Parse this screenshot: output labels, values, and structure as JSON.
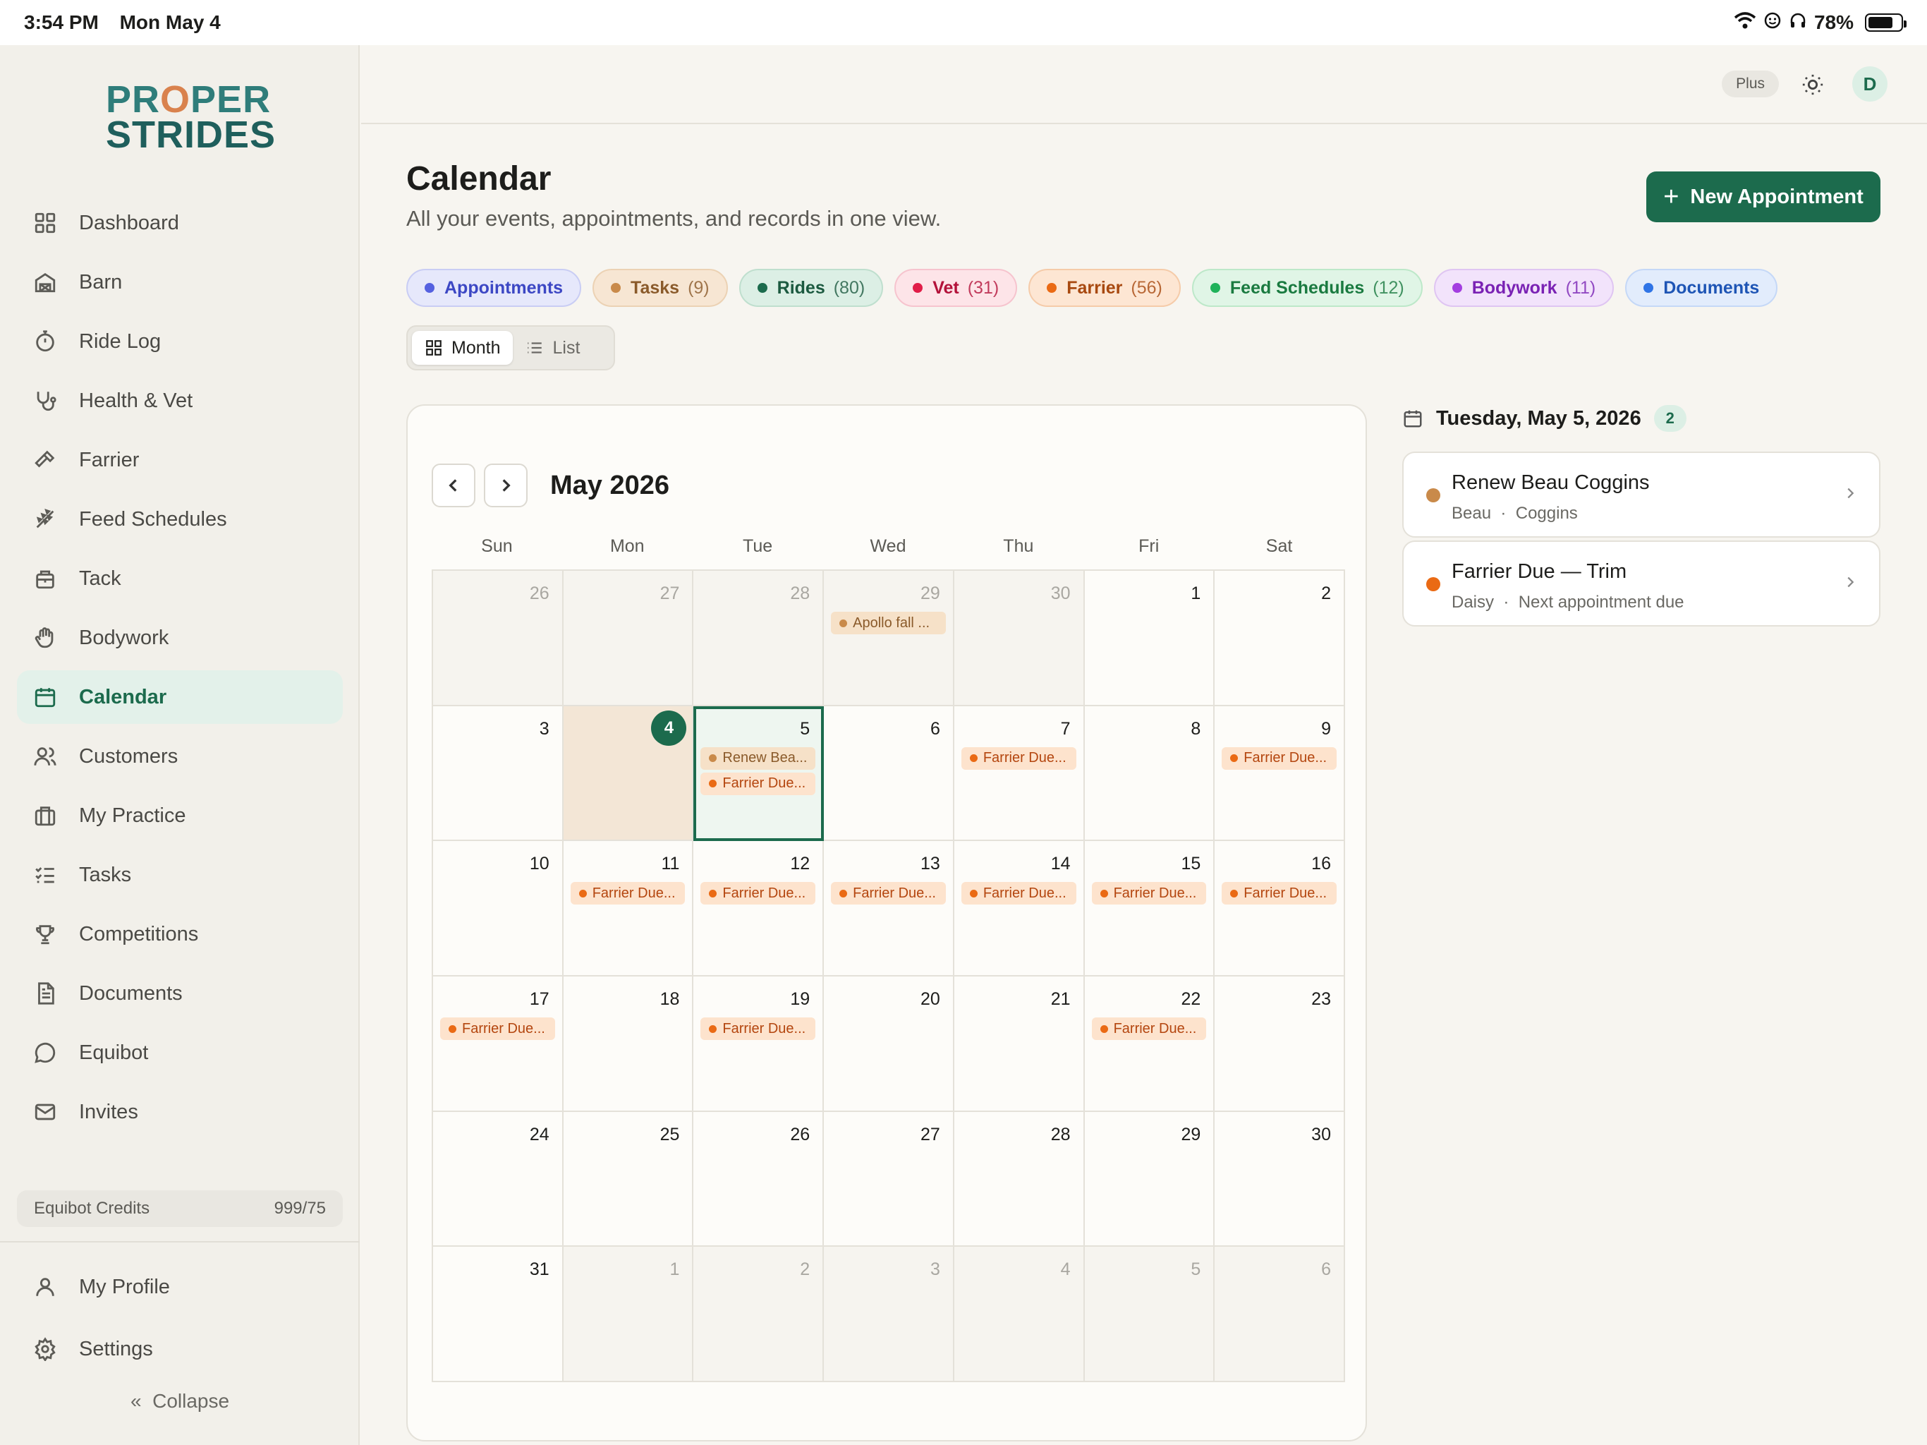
{
  "status": {
    "time": "3:54 PM",
    "date": "Mon May 4",
    "battery": "78%",
    "battery_level": 0.78
  },
  "logo": {
    "line1_a": "PR",
    "line1_o": "O",
    "line1_b": "PER",
    "line2": "STRIDES"
  },
  "nav": [
    {
      "label": "Dashboard",
      "icon": "dashboard-icon"
    },
    {
      "label": "Barn",
      "icon": "barn-icon"
    },
    {
      "label": "Ride Log",
      "icon": "stopwatch-icon"
    },
    {
      "label": "Health & Vet",
      "icon": "stethoscope-icon"
    },
    {
      "label": "Farrier",
      "icon": "hammer-icon"
    },
    {
      "label": "Feed Schedules",
      "icon": "wheat-icon"
    },
    {
      "label": "Tack",
      "icon": "tack-icon"
    },
    {
      "label": "Bodywork",
      "icon": "hand-icon"
    },
    {
      "label": "Calendar",
      "icon": "calendar-icon",
      "active": true
    },
    {
      "label": "Customers",
      "icon": "users-icon"
    },
    {
      "label": "My Practice",
      "icon": "briefcase-icon"
    },
    {
      "label": "Tasks",
      "icon": "checklist-icon"
    },
    {
      "label": "Competitions",
      "icon": "trophy-icon"
    },
    {
      "label": "Documents",
      "icon": "document-icon"
    },
    {
      "label": "Equibot",
      "icon": "chat-icon"
    },
    {
      "label": "Invites",
      "icon": "mail-icon"
    }
  ],
  "credits": {
    "label": "Equibot Credits",
    "value": "999/75"
  },
  "bottom_nav": [
    {
      "label": "My Profile",
      "icon": "user-icon"
    },
    {
      "label": "Settings",
      "icon": "gear-icon"
    }
  ],
  "collapse_label": "Collapse",
  "topbar": {
    "plan": "Plus",
    "avatar_letter": "D"
  },
  "header": {
    "title": "Calendar",
    "subtitle": "All your events, appointments, and records in one view.",
    "new_button": "New Appointment"
  },
  "filters": [
    {
      "label": "Appointments",
      "count": "",
      "color": "#5561e0",
      "bg": "#e6e8fb",
      "border": "#c9cdf4",
      "text": "#3c47c4"
    },
    {
      "label": "Tasks",
      "count": "(9)",
      "color": "#c98a4a",
      "bg": "#f7e6d3",
      "border": "#ecd2b4",
      "text": "#8a5a2a"
    },
    {
      "label": "Rides",
      "count": "(80)",
      "color": "#1c6b4d",
      "bg": "#dcefe5",
      "border": "#bfdfce",
      "text": "#1c5a40"
    },
    {
      "label": "Vet",
      "count": "(31)",
      "color": "#e11d48",
      "bg": "#fde4e8",
      "border": "#f6c4ce",
      "text": "#b3123a"
    },
    {
      "label": "Farrier",
      "count": "(56)",
      "color": "#ea6a14",
      "bg": "#fde6d3",
      "border": "#f5cba9",
      "text": "#a84910"
    },
    {
      "label": "Feed Schedules",
      "count": "(12)",
      "color": "#1fb25a",
      "bg": "#e0f5e6",
      "border": "#bde8c9",
      "text": "#1a7a40"
    },
    {
      "label": "Bodywork",
      "count": "(11)",
      "color": "#a33ee0",
      "bg": "#f2e3fb",
      "border": "#dfc5f2",
      "text": "#7a22b4"
    },
    {
      "label": "Documents",
      "count": "",
      "color": "#2f74e6",
      "bg": "#e2ecfc",
      "border": "#c5d8f7",
      "text": "#1e55b5"
    }
  ],
  "view_toggle": {
    "month": "Month",
    "list": "List"
  },
  "calendar": {
    "month_label": "May 2026",
    "weekdays": [
      "Sun",
      "Mon",
      "Tue",
      "Wed",
      "Thu",
      "Fri",
      "Sat"
    ],
    "days": [
      {
        "n": "26",
        "out": true
      },
      {
        "n": "27",
        "out": true
      },
      {
        "n": "28",
        "out": true
      },
      {
        "n": "29",
        "out": true,
        "events": [
          {
            "t": "Apollo fall ...",
            "k": "task"
          }
        ]
      },
      {
        "n": "30",
        "out": true
      },
      {
        "n": "1"
      },
      {
        "n": "2"
      },
      {
        "n": "3"
      },
      {
        "n": "4",
        "today": true
      },
      {
        "n": "5",
        "selected": true,
        "events": [
          {
            "t": "Renew Bea...",
            "k": "task"
          },
          {
            "t": "Farrier Due...",
            "k": "farrier"
          }
        ]
      },
      {
        "n": "6"
      },
      {
        "n": "7",
        "events": [
          {
            "t": "Farrier Due...",
            "k": "farrier"
          }
        ]
      },
      {
        "n": "8"
      },
      {
        "n": "9",
        "events": [
          {
            "t": "Farrier Due...",
            "k": "farrier"
          }
        ]
      },
      {
        "n": "10"
      },
      {
        "n": "11",
        "events": [
          {
            "t": "Farrier Due...",
            "k": "farrier"
          }
        ]
      },
      {
        "n": "12",
        "events": [
          {
            "t": "Farrier Due...",
            "k": "farrier"
          }
        ]
      },
      {
        "n": "13",
        "events": [
          {
            "t": "Farrier Due...",
            "k": "farrier"
          }
        ]
      },
      {
        "n": "14",
        "events": [
          {
            "t": "Farrier Due...",
            "k": "farrier"
          }
        ]
      },
      {
        "n": "15",
        "events": [
          {
            "t": "Farrier Due...",
            "k": "farrier"
          }
        ]
      },
      {
        "n": "16",
        "events": [
          {
            "t": "Farrier Due...",
            "k": "farrier"
          }
        ]
      },
      {
        "n": "17",
        "events": [
          {
            "t": "Farrier Due...",
            "k": "farrier"
          }
        ]
      },
      {
        "n": "18"
      },
      {
        "n": "19",
        "events": [
          {
            "t": "Farrier Due...",
            "k": "farrier"
          }
        ]
      },
      {
        "n": "20"
      },
      {
        "n": "21"
      },
      {
        "n": "22",
        "events": [
          {
            "t": "Farrier Due...",
            "k": "farrier"
          }
        ]
      },
      {
        "n": "23"
      },
      {
        "n": "24"
      },
      {
        "n": "25"
      },
      {
        "n": "26"
      },
      {
        "n": "27"
      },
      {
        "n": "28"
      },
      {
        "n": "29"
      },
      {
        "n": "30"
      },
      {
        "n": "31"
      },
      {
        "n": "1",
        "out": true
      },
      {
        "n": "2",
        "out": true
      },
      {
        "n": "3",
        "out": true
      },
      {
        "n": "4",
        "out": true
      },
      {
        "n": "5",
        "out": true
      },
      {
        "n": "6",
        "out": true
      }
    ]
  },
  "detail": {
    "title": "Tuesday, May 5, 2026",
    "count": "2",
    "items": [
      {
        "title": "Renew Beau Coggins",
        "sub1": "Beau",
        "sub2": "Coggins",
        "color": "#c98a4a"
      },
      {
        "title": "Farrier Due — Trim",
        "sub1": "Daisy",
        "sub2": "Next appointment due",
        "color": "#ea6a14"
      }
    ]
  }
}
